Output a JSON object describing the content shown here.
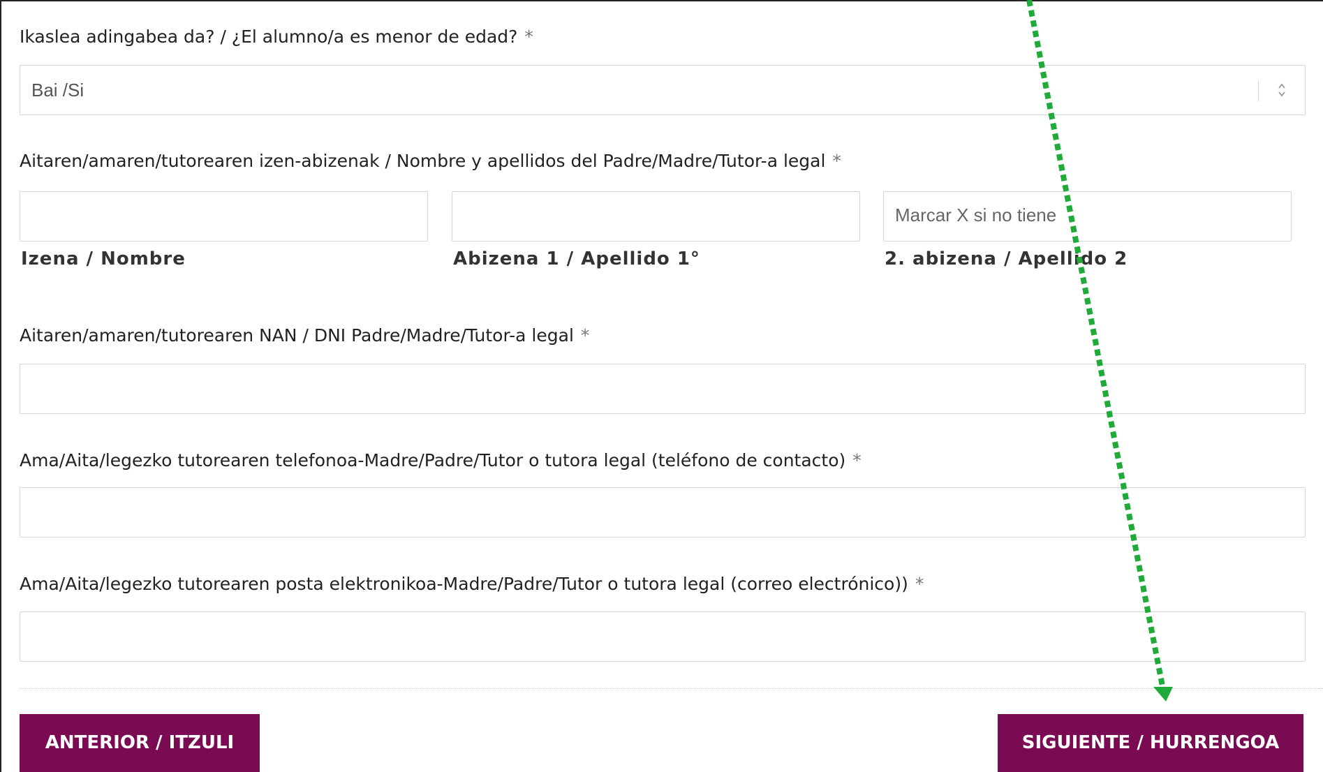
{
  "form": {
    "minor_question": {
      "label": "Ikaslea adingabea da? / ¿El alumno/a es menor de edad?",
      "required_mark": "*",
      "selected_value": "Bai /Si"
    },
    "guardian_name": {
      "label": "Aitaren/amaren/tutorearen izen-abizenak / Nombre y apellidos del Padre/Madre/Tutor-a legal",
      "required_mark": "*",
      "first_name": {
        "value": "",
        "sublabel": "Izena / Nombre"
      },
      "surname1": {
        "value": "",
        "sublabel": "Abizena 1 / Apellido 1°"
      },
      "surname2": {
        "value": "",
        "placeholder": "Marcar X si no tiene",
        "sublabel": "2. abizena / Apellido 2"
      }
    },
    "guardian_id": {
      "label": "Aitaren/amaren/tutorearen NAN / DNI Padre/Madre/Tutor-a legal",
      "required_mark": "*",
      "value": ""
    },
    "guardian_phone": {
      "label": "Ama/Aita/legezko tutorearen telefonoa-Madre/Padre/Tutor o tutora legal (teléfono de contacto)",
      "required_mark": "*",
      "value": ""
    },
    "guardian_email": {
      "label": "Ama/Aita/legezko tutorearen posta elektronikoa-Madre/Padre/Tutor o tutora legal (correo electrónico))",
      "required_mark": "*",
      "value": ""
    }
  },
  "buttons": {
    "previous": "ANTERIOR / ITZULI",
    "next": "SIGUIENTE / HURRENGOA"
  },
  "colors": {
    "button_bg": "#7a0a52",
    "annotation_arrow": "#1faa3a"
  },
  "icons": {
    "select_arrows": "updown-chevron-icon",
    "annotation": "dotted-arrow-icon"
  }
}
